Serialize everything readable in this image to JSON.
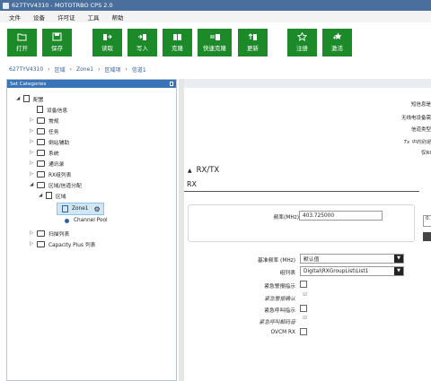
{
  "window": {
    "title": "627TYV4310 - MOTOTRBO CPS 2.0"
  },
  "menu": [
    "文件",
    "设备",
    "许可证",
    "工具",
    "帮助"
  ],
  "toolbar": {
    "buttons": [
      {
        "label": "打开"
      },
      {
        "label": "保存"
      },
      {
        "label": "读取"
      },
      {
        "label": "写入"
      },
      {
        "label": "克隆"
      },
      {
        "label": "快速克隆"
      },
      {
        "label": "更新"
      },
      {
        "label": "注册"
      },
      {
        "label": "激活"
      }
    ]
  },
  "breadcrumb": [
    "627TYV4310",
    "区域",
    "Zone1",
    "区域项",
    "信道1"
  ],
  "left_panel": {
    "title": "Set Categories",
    "tree": [
      {
        "label": "配置"
      },
      {
        "label": "设备信息"
      },
      {
        "label": "常规"
      },
      {
        "label": "任务"
      },
      {
        "label": "倒站辅助"
      },
      {
        "label": "系统"
      },
      {
        "label": "通讯录"
      },
      {
        "label": "RX组列表"
      },
      {
        "label": "区域/信道分配"
      },
      {
        "label": "区域"
      },
      {
        "label": "Zone1"
      },
      {
        "label": "Channel Pool"
      },
      {
        "label": "扫描列表"
      },
      {
        "label": "Capacity Plus 列表"
      }
    ]
  },
  "right_panel": {
    "info_labels": [
      "短信息是",
      "无线电设备需",
      "信道类型",
      "Tx 中的别是",
      "仅RI"
    ],
    "section_title": "RX/TX",
    "sub_title": "RX",
    "freq_label": "频率(MHz)",
    "freq_value": "403.725000",
    "clipped_value": "0.",
    "fields": [
      {
        "label": "基准频率 (MHz)",
        "value": "默认值"
      },
      {
        "label": "组列表",
        "value": "Digital\\RXGroupList\\List1"
      }
    ],
    "checks": [
      {
        "label": "紧急警报指示",
        "italic": false,
        "enabled": true
      },
      {
        "label": "紧急警报确认",
        "italic": true,
        "enabled": false
      },
      {
        "label": "紧急呼叫指示",
        "italic": false,
        "enabled": true
      },
      {
        "label": "紧急呼叫解码音",
        "italic": true,
        "enabled": false
      },
      {
        "label": "OVCM RX",
        "italic": false,
        "enabled": true
      }
    ]
  },
  "colors": {
    "title_bar": "#4a6f9c",
    "toolbar_button": "#1d8a2a",
    "panel_header": "#3a74b8",
    "link": "#2a62a8"
  }
}
